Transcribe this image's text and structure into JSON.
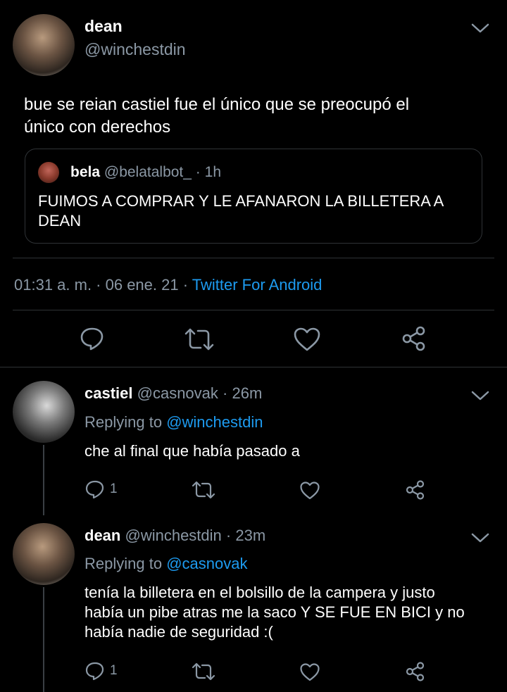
{
  "main_tweet": {
    "display_name": "dean",
    "handle": "@winchestdin",
    "text_line1": "bue se reian castiel fue el único que se preocupó el",
    "text_line2": "único con derechos",
    "quote": {
      "display_name": "bela",
      "handle": "@belatalbot_",
      "separator": "·",
      "time": "1h",
      "text_line1": "FUIMOS A COMPRAR Y LE AFANARON  LA BILLETERA A",
      "text_line2": "DEAN"
    },
    "timestamp": "01:31 a. m. · 06 ene. 21 ·",
    "source": "Twitter For Android"
  },
  "replies": [
    {
      "display_name": "castiel",
      "handle": "@casnovak",
      "separator": "·",
      "time": "26m",
      "replying_prefix": "Replying to",
      "replying_to": "@winchestdin",
      "text_line1": "che al final que había pasado a",
      "text_line2": "",
      "text_line3": "",
      "reply_count": "1"
    },
    {
      "display_name": "dean",
      "handle": "@winchestdin",
      "separator": "·",
      "time": "23m",
      "replying_prefix": "Replying to",
      "replying_to": "@casnovak",
      "text_line1": "tenía la billetera en el bolsillo de la campera y justo",
      "text_line2": "había un pibe atras me la saco Y SE FUE EN BICI y no",
      "text_line3": "había nadie de seguridad :(",
      "reply_count": "1"
    }
  ],
  "colors": {
    "background": "#000000",
    "text": "#ffffff",
    "muted": "#8b98a5",
    "link": "#1d9bf0",
    "divider": "#2f3336"
  },
  "icons": [
    "chevron-down-icon",
    "reply-icon",
    "retweet-icon",
    "like-icon",
    "share-icon"
  ]
}
